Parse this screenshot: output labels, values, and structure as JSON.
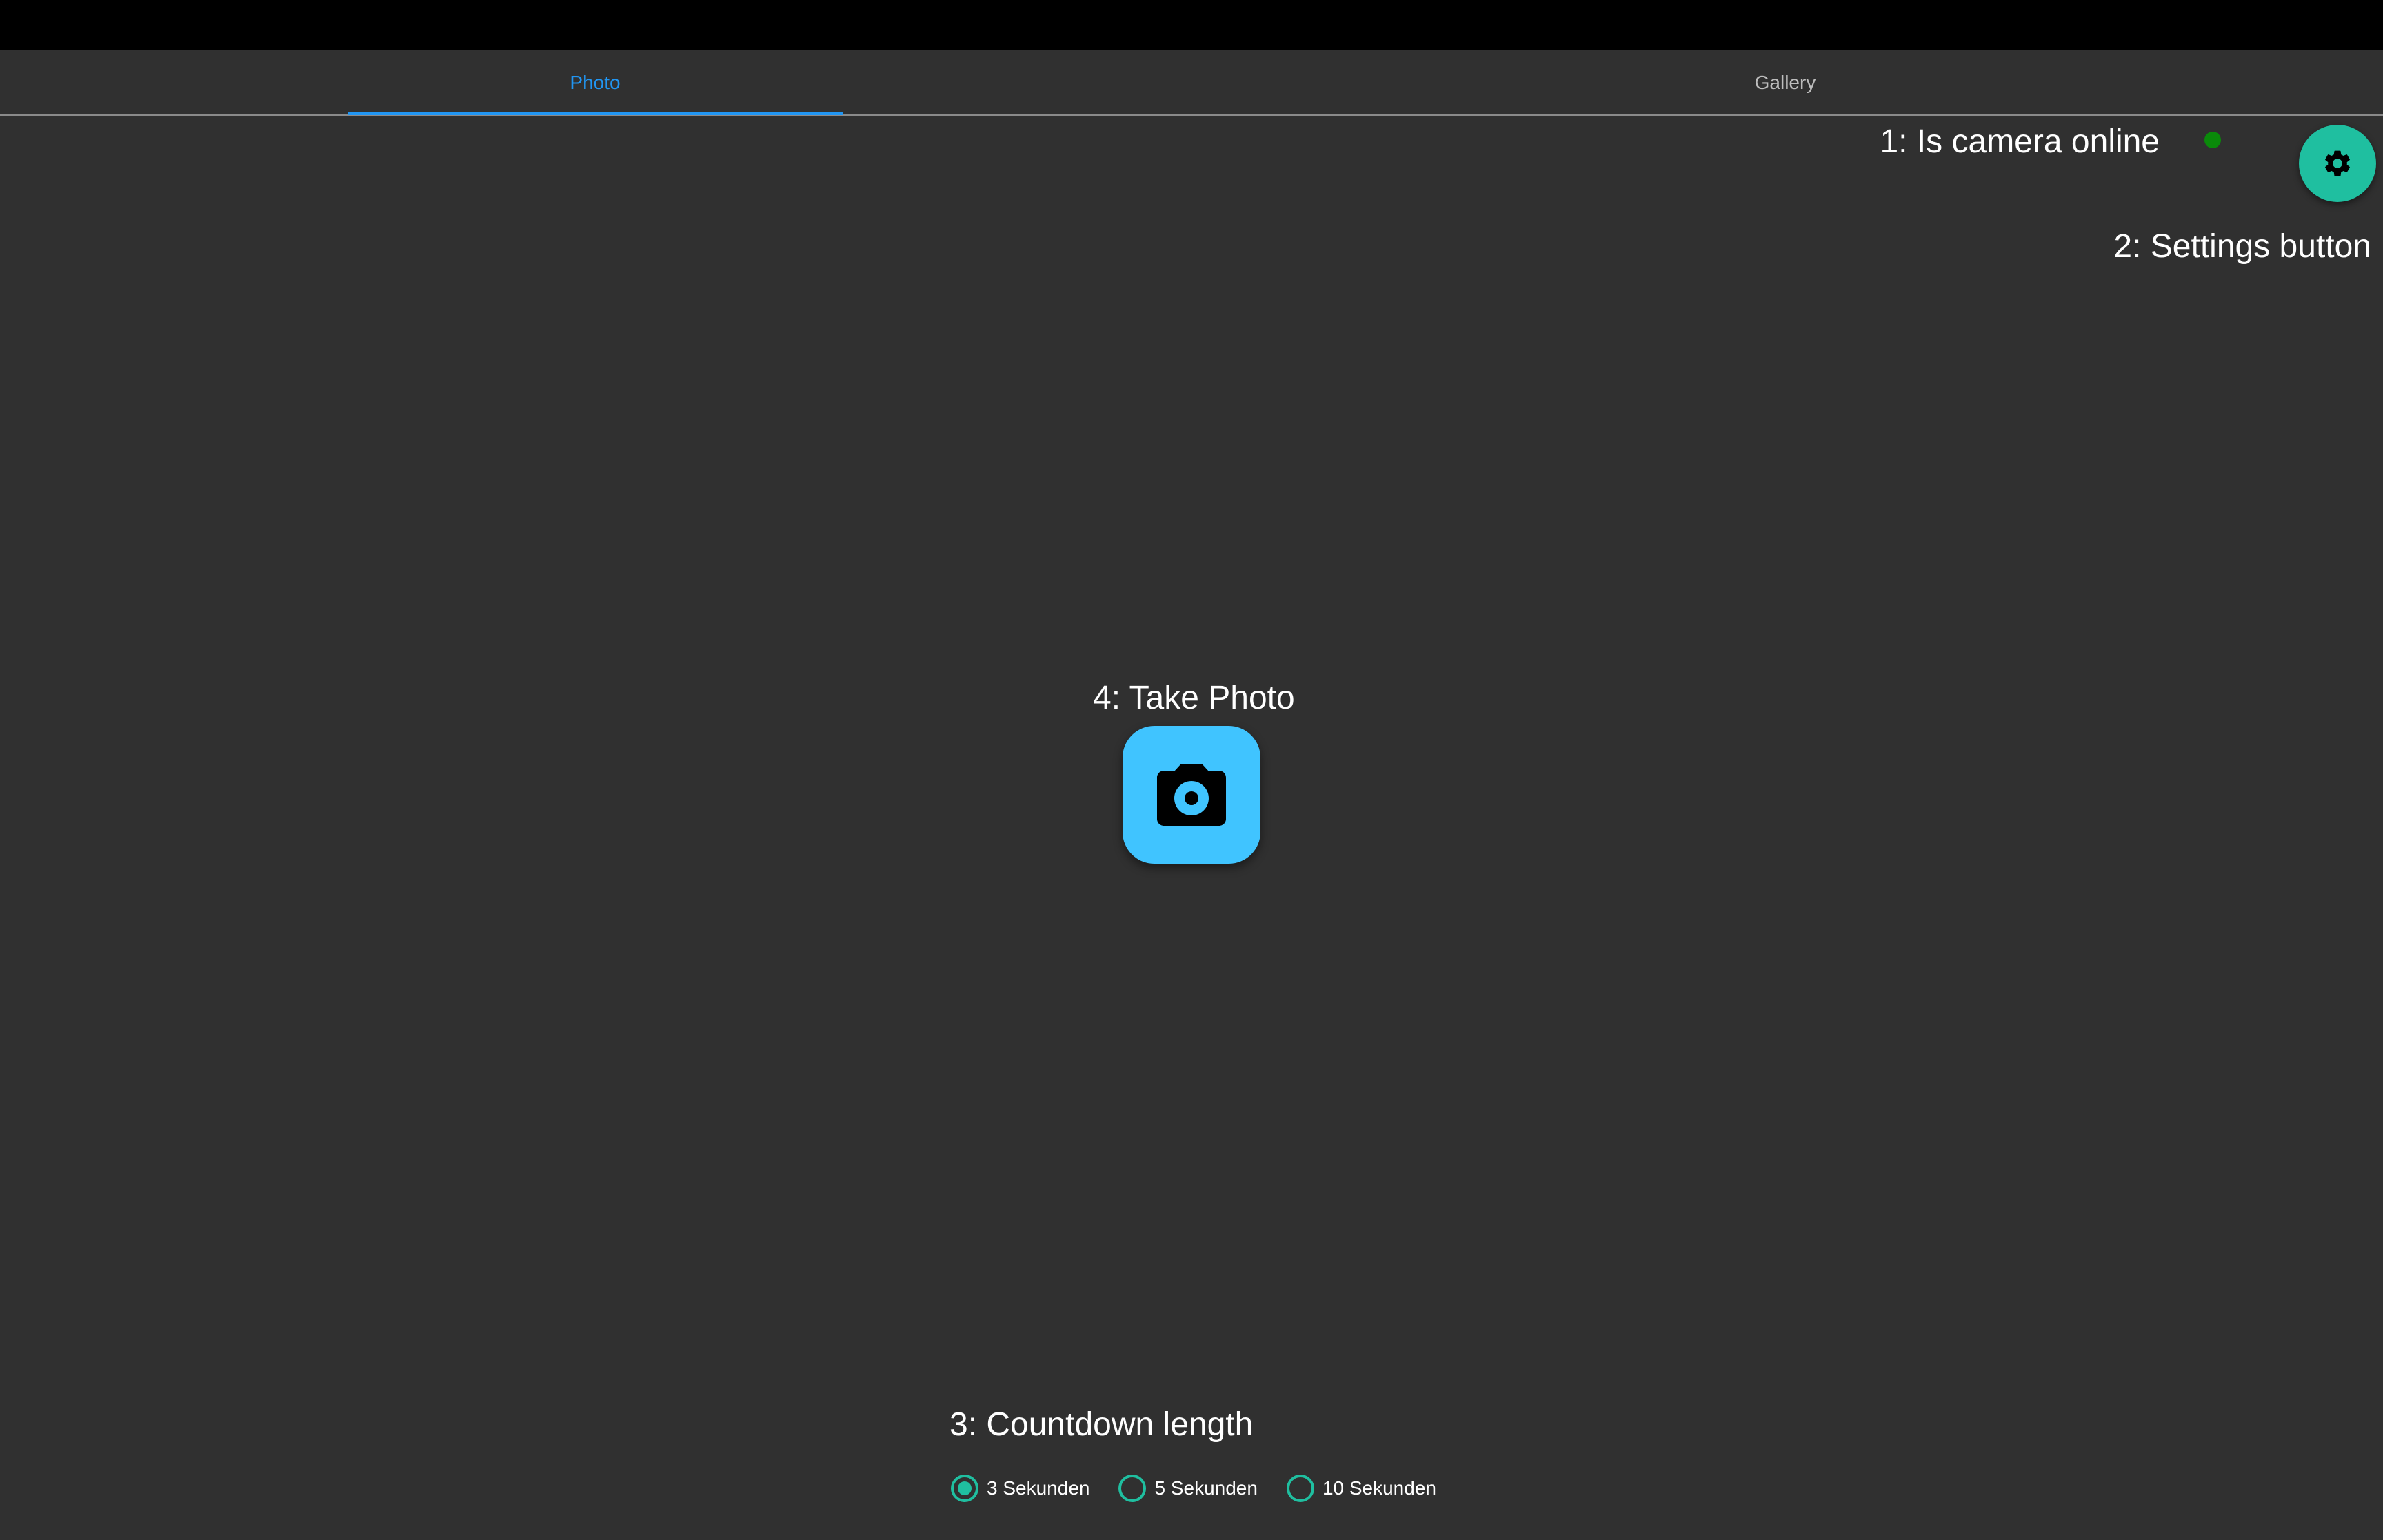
{
  "tabs": [
    {
      "label": "Photo",
      "active": true
    },
    {
      "label": "Gallery",
      "active": false
    }
  ],
  "annotations": {
    "camera_online": "1: Is camera online",
    "settings_button": "2: Settings button",
    "countdown_length": "3: Countdown length",
    "take_photo": "4: Take Photo"
  },
  "status": {
    "camera_online": true,
    "color": "#0a8a0a"
  },
  "settings_button": {
    "icon": "gear-icon",
    "color": "#1fbfa0"
  },
  "photo_button": {
    "icon": "camera-icon",
    "color": "#40c4ff"
  },
  "countdown": {
    "selected": "3 Sekunden",
    "options": [
      {
        "label": "3 Sekunden",
        "selected": true
      },
      {
        "label": "5 Sekunden",
        "selected": false
      },
      {
        "label": "10 Sekunden",
        "selected": false
      }
    ]
  },
  "colors": {
    "background": "#303030",
    "top_bar": "#000000",
    "active_tab": "#2196f3",
    "inactive_tab": "#bdbdbd",
    "radio_accent": "#1fbfa0"
  }
}
